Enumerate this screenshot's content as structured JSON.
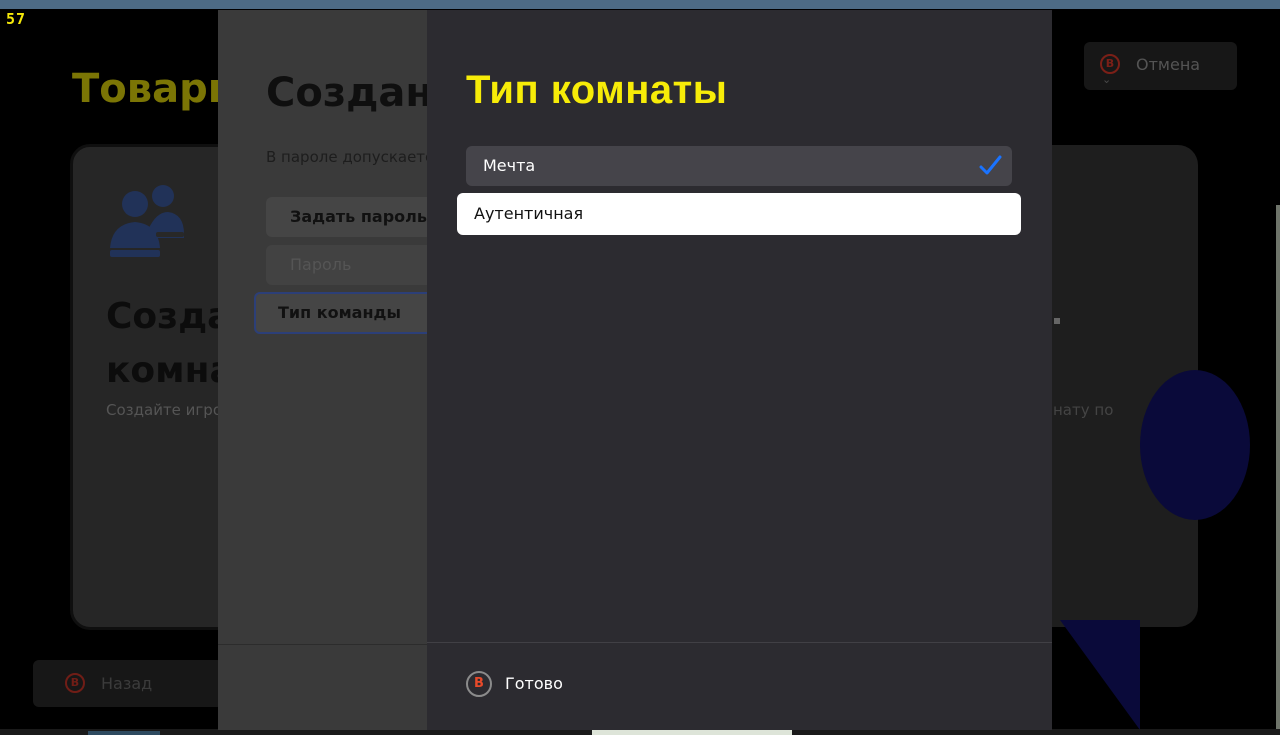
{
  "fps_counter": "57",
  "background": {
    "page_title": "Товари",
    "cancel_label": "Отмена",
    "cancel_badge": "B",
    "card_title": "Создан\nкомна",
    "card_subtitle": "Создайте игро",
    "right_text": "нату по",
    "back_label": "Назад",
    "back_badge": "B"
  },
  "middle_panel": {
    "title": "Создание",
    "hint": "В пароле допускается",
    "rows": [
      {
        "label": "Задать пароль"
      },
      {
        "label": "Пароль"
      },
      {
        "label": "Тип команды"
      }
    ]
  },
  "modal": {
    "title": "Тип комнаты",
    "options": [
      {
        "label": "Мечта",
        "selected": true
      },
      {
        "label": "Аутентичная",
        "selected": false
      }
    ],
    "footer": {
      "badge": "B",
      "done_label": "Готово"
    }
  },
  "colors": {
    "accent_yellow": "#f7ec08",
    "check_blue": "#1a73ff",
    "button_red": "#e84a2a"
  }
}
